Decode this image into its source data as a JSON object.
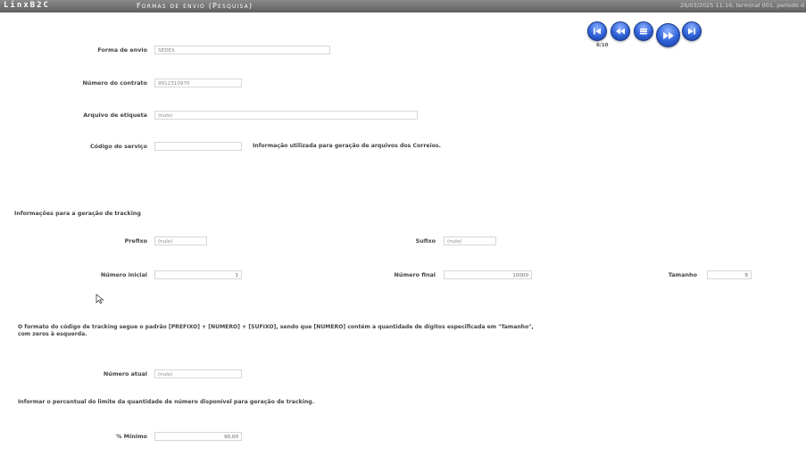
{
  "app": {
    "brand": "LinxB2C",
    "title": "Formas de envio (Pesquisa)",
    "status": "26/03/2025 11:16, terminal 001, período d"
  },
  "nav": {
    "page_indicator": "8/10",
    "buttons": [
      "first",
      "previous",
      "list",
      "next",
      "last"
    ]
  },
  "form": {
    "forma_envio": {
      "label": "Forma de envio",
      "value": "SEDEX"
    },
    "numero_contrato": {
      "label": "Número do contrato",
      "value": "9912310970"
    },
    "arquivo_etiqueta": {
      "label": "Arquivo de etiqueta",
      "value": "(nulo)"
    },
    "codigo_servico": {
      "label": "Código do serviço",
      "value": "",
      "note": "Informação utilizada para geração de arquivos dos Correios."
    }
  },
  "tracking": {
    "section_title": "Informações para a geração de tracking",
    "prefixo": {
      "label": "Prefixo",
      "value": "(nulo)"
    },
    "sufixo": {
      "label": "Sufixo",
      "value": "(nulo)"
    },
    "numero_inicial": {
      "label": "Número inicial",
      "value": "1"
    },
    "numero_final": {
      "label": "Número final",
      "value": "10000"
    },
    "tamanho": {
      "label": "Tamanho",
      "value": "8"
    },
    "explanation_line1": "O formato do código de tracking segue o padrão [PREFIXO] + [NUMERO] + [SUFIXO], sendo que [NUMERO] contém a quantidade de dígitos especificada em \"Tamanho\",",
    "explanation_line2": "com zeros à esquerda.",
    "numero_atual": {
      "label": "Número atual",
      "value": "(nulo)"
    },
    "percent_note": "Informar o percentual do limite da quantidade de número disponível para geração de tracking.",
    "minimo": {
      "label": "% Mínimo",
      "value": "90,00"
    }
  },
  "colors": {
    "titlebar": "#6f6f6f",
    "nav_button": "#2f62d8",
    "input_border": "#d6d6d6"
  }
}
